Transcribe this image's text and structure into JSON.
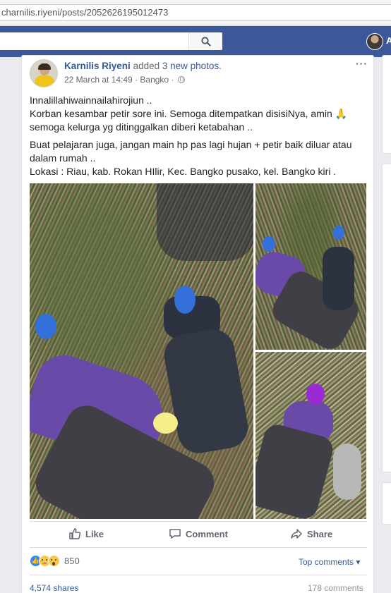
{
  "browser": {
    "url": "charnilis.riyeni/posts/2052626195012473"
  },
  "topbar": {
    "user_initial": "A"
  },
  "post": {
    "author": "Karnilis Riyeni",
    "action": "added",
    "photos_link": "3 new photos.",
    "date": "22 March at 14:49",
    "separator": " · ",
    "location": "Bangko",
    "more": "···",
    "paragraph1": [
      "Innalillahiwainnailahirojiun ..",
      "Korban kesambar petir sore ini. Semoga ditempatkan disisiNya, amin 🙏",
      "semoga kelurga yg ditinggalkan diberi ketabahan .."
    ],
    "paragraph2": [
      "Buat pelajaran juga, jangan main hp pas lagi hujan + petir baik diluar atau",
      "dalam rumah ..",
      "Lokasi : Riau, kab. Rokan HIlir, Kec. Bangko pusako, kel. Bangko kiri ."
    ]
  },
  "actions": {
    "like": "Like",
    "comment": "Comment",
    "share": "Share"
  },
  "stats": {
    "reaction_count": "850",
    "top_comments": "Top comments ▾",
    "shares": "4,574 shares",
    "comments": "178 comments"
  },
  "colors": {
    "fb_blue": "#3b5998",
    "link": "#365899",
    "background": "#e9ebee"
  },
  "icons": [
    "search-icon",
    "globe-icon",
    "more-icon",
    "like-icon",
    "comment-icon",
    "share-icon",
    "like-reaction-icon",
    "sad-reaction-icon",
    "wow-reaction-icon"
  ]
}
